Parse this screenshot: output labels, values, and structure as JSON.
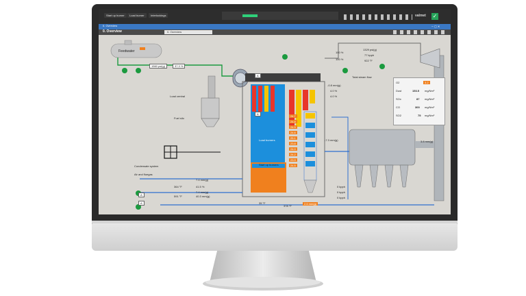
{
  "window": {
    "top_buttons": [
      "Start up burner",
      "Load burner",
      "Interlockings"
    ],
    "top_right_label": "valmet"
  },
  "tabs": {
    "titlebar_tab": "0. Overview",
    "header": "0. Overview",
    "secondary_tab": "0. Overview"
  },
  "labels": {
    "feedwater": "Feedwater",
    "load_central": "Load central",
    "fuel_silo": "Fuel silo",
    "condensate_system": "Condensate system",
    "air_and_fluegas": "Air and fluegas",
    "load_burners": "Load burners",
    "startup_burners": "Start up burners",
    "total_steam_flow": "Total steam flow"
  },
  "values": {
    "feedwater_pressure": "1560 psi(g)",
    "feedwater_pct": "37.3 %",
    "steam_pressure_top": "1329 psi(g)",
    "steam_flow_top": "77 kpph",
    "steam_temp": "922 °F",
    "valve_pct": "100 %",
    "valve_pct2": "100 %",
    "furnace_pressure": "-0.8 mm(g)",
    "draft_a": "4.0 %",
    "draft_b": "4.0 %",
    "pressure_mid": "-7.3 mm(g)",
    "pressure_right": "3.8 mm(g)",
    "air_pressure": "7.4 mm(g)",
    "air_pct": "41.5 %",
    "air_temp": "364 °F",
    "air_pressure2": "7.4 mm(g)",
    "fluegas_temp": "591 °F",
    "fluegas_pressure": "40.3 mm(g)",
    "bottom_temp": "378 °F",
    "bottom_temp2": "35 °F",
    "bottom_pressure": "2.6 mm(g)",
    "kpph_1": "0 kpph",
    "kpph_2": "0 kpph",
    "kpph_3": "0 kpph"
  },
  "emissions": [
    {
      "name": "O2",
      "value": "3.2",
      "unit": ""
    },
    {
      "name": "Dust",
      "value": "153.5",
      "unit": "mg/Nm³"
    },
    {
      "name": "SOx",
      "value": "87",
      "unit": "mg/Nm³"
    },
    {
      "name": "CO",
      "value": "300",
      "unit": "mg/Nm³"
    },
    {
      "name": "SO2",
      "value": "75",
      "unit": "mg/Nm³"
    }
  ],
  "burner_readings": [
    "24.7",
    "24.8",
    "24.9",
    "24.6",
    "25.1",
    "23.8",
    "24.0",
    "24.2",
    "23.9",
    "24.5"
  ],
  "colors": {
    "accent": "#f0801e",
    "boiler_blue": "#1c8fdc",
    "pipe_blue": "#2f6fd0",
    "pipe_green": "#1b9a3f",
    "hot_red": "#e8352a",
    "hot_yellow": "#f5c400",
    "hmi_bg": "#d9d7d2"
  }
}
